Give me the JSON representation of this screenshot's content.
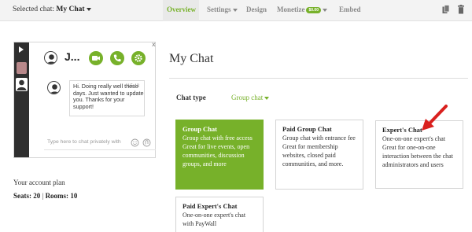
{
  "topbar": {
    "selected_prefix": "Selected chat:",
    "selected_chat": "My Chat",
    "nav": {
      "overview": "Overview",
      "settings": "Settings",
      "design": "Design",
      "monetize": "Monetize",
      "monetize_badge": "$0.00",
      "embed": "Embed"
    },
    "icons": [
      "copy-icon",
      "trash-icon"
    ]
  },
  "widget": {
    "close": "x",
    "header_name": "J...",
    "header_buttons": [
      "video-icon",
      "phone-icon",
      "gear-icon"
    ],
    "message": {
      "text": "Hi. Doing really well these days. Just wanted to update you. Thanks for your support!",
      "time": "15:43"
    },
    "input_placeholder": "Type here to chat privately with"
  },
  "account": {
    "label": "Your account plan",
    "seats_label": "Seats:",
    "seats": "20",
    "rooms_label": "Rooms:",
    "rooms": "10"
  },
  "main": {
    "title": "My Chat",
    "chat_type_label": "Chat type",
    "chat_type_value": "Group chat"
  },
  "cards": [
    {
      "title": "Group Chat",
      "desc": "Group chat with free access Great for live events, open communities, discussion groups, and more",
      "active": true
    },
    {
      "title": "Paid Group Chat",
      "desc": "Group chat with entrance fee Great for membership websites, closed paid communities, and more.",
      "active": false
    },
    {
      "title": "Expert's Chat",
      "desc": "One-on-one expert's chat Great for one-on-one interaction between the chat administrators and users",
      "active": false
    },
    {
      "title": "Paid Expert's Chat",
      "desc": "One-on-one expert's chat with PayWall",
      "active": false
    }
  ],
  "colors": {
    "accent": "#77b12a",
    "arrow": "#d9201e",
    "sidebar_dark": "#2f2f2f"
  }
}
